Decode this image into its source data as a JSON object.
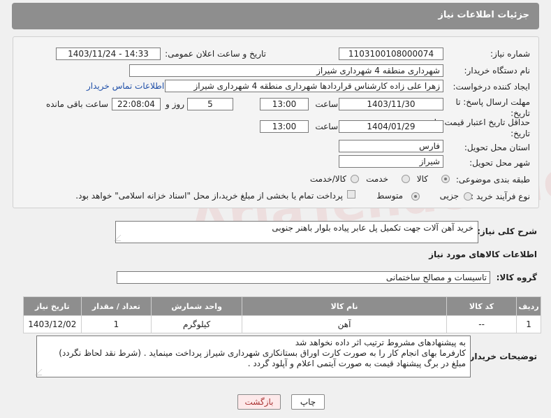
{
  "header": {
    "title": "جزئیات اطلاعات نیاز"
  },
  "form": {
    "need_number_label": "شماره نیاز:",
    "need_number": "1103100108000074",
    "announce_label": "تاریخ و ساعت اعلان عمومی:",
    "announce_value": "1403/11/24 - 14:33",
    "buyer_org_label": "نام دستگاه خریدار:",
    "buyer_org": "شهرداری منطقه 4 شهرداری شیراز",
    "requester_label": "ایجاد کننده درخواست:",
    "requester": "زهرا علی زاده کارشناس قراردادها شهرداری منطقه 4 شهرداری شیراز",
    "contact_link": "اطلاعات تماس خریدار",
    "deadline_label": "مهلت ارسال پاسخ: تا تاریخ:",
    "deadline_date": "1403/11/30",
    "time_label": "ساعت",
    "deadline_time": "13:00",
    "days_value": "5",
    "days_label": "روز و",
    "remaining_time": "22:08:04",
    "remaining_label": "ساعت باقی مانده",
    "price_validity_label": "حداقل تاریخ اعتبار قیمت: تا تاریخ:",
    "price_validity_date": "1404/01/29",
    "price_validity_time": "13:00",
    "province_label": "استان محل تحویل:",
    "province": "فارس",
    "city_label": "شهر محل تحویل:",
    "city": "شیراز",
    "category_label": "طبقه بندی موضوعی:",
    "category_options": [
      "کالا",
      "خدمت",
      "کالا/خدمت"
    ],
    "process_label": "نوع فرآیند خرید :",
    "process_options": [
      "جزیی",
      "متوسط"
    ],
    "payment_note": "پرداخت تمام یا بخشی از مبلغ خرید،از محل \"اسناد خزانه اسلامی\" خواهد بود."
  },
  "summary": {
    "label": "شرح کلی نیاز:",
    "text": "خرید آهن آلات جهت تکمیل پل عابر پیاده بلوار باهنر جنوبی"
  },
  "goods": {
    "section_title": "اطلاعات کالاهای مورد نیاز",
    "group_label": "گروه کالا:",
    "group_value": "تاسیسات و مصالح ساختمانی",
    "columns": [
      "ردیف",
      "کد کالا",
      "نام کالا",
      "واحد شمارش",
      "تعداد / مقدار",
      "تاریخ نیاز"
    ],
    "rows": [
      [
        "1",
        "--",
        "آهن",
        "کیلوگرم",
        "1",
        "1403/12/02"
      ]
    ]
  },
  "notes": {
    "label": "توضیحات خریدار:",
    "lines": [
      "به پیشنهادهای مشروط ترتیب اثر داده نخواهد شد",
      "کارفرما بهای انجام کار را به صورت کارت اوراق بستانکاری شهرداری شیراز پرداخت مینماید . (شرط نقد لحاظ نگردد)",
      "مبلغ در برگ پیشنهاد قیمت به صورت آیتمی اعلام و آپلود گردد ."
    ]
  },
  "buttons": {
    "print": "چاپ",
    "back": "بازگشت"
  },
  "watermark": "AriaTender.neT"
}
